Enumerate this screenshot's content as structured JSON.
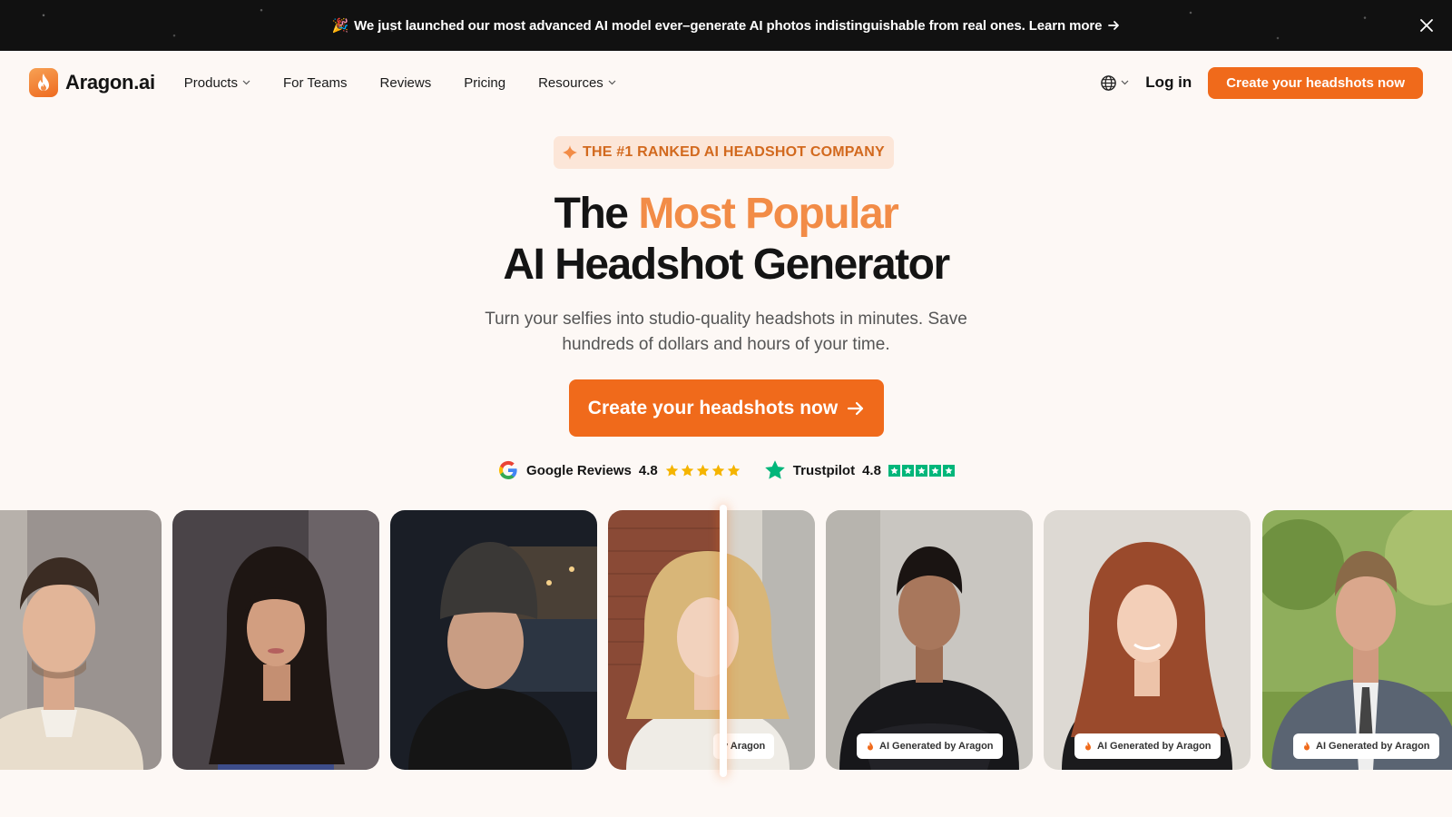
{
  "announcement": {
    "emoji": "🎉",
    "text": "We just launched our most advanced AI model ever–generate AI photos indistinguishable from real ones. Learn more"
  },
  "nav": {
    "logo_text": "Aragon.ai",
    "links": [
      {
        "label": "Products",
        "dropdown": true
      },
      {
        "label": "For Teams",
        "dropdown": false
      },
      {
        "label": "Reviews",
        "dropdown": false
      },
      {
        "label": "Pricing",
        "dropdown": false
      },
      {
        "label": "Resources",
        "dropdown": true
      }
    ],
    "login_label": "Log in",
    "cta_label": "Create your headshots now"
  },
  "hero": {
    "badge": "THE #1 RANKED AI HEADSHOT COMPANY",
    "title_prefix": "The",
    "title_accent": "Most Popular",
    "title_line2": "AI Headshot Generator",
    "subtitle": "Turn your selfies into studio-quality headshots in minutes. Save hundreds of dollars and hours of your time.",
    "cta_label": "Create your headshots now"
  },
  "ratings": {
    "google": {
      "label": "Google Reviews",
      "score": "4.8"
    },
    "trustpilot": {
      "label": "Trustpilot",
      "score": "4.8"
    }
  },
  "gallery": {
    "ai_label": "AI Generated by Aragon",
    "partial_label": "y Aragon"
  },
  "colors": {
    "accent": "#f06a1b",
    "accent_light": "#f28c47",
    "badge_bg": "#fce6d8",
    "trustpilot": "#00b67a",
    "star_gold": "#f5b400"
  }
}
